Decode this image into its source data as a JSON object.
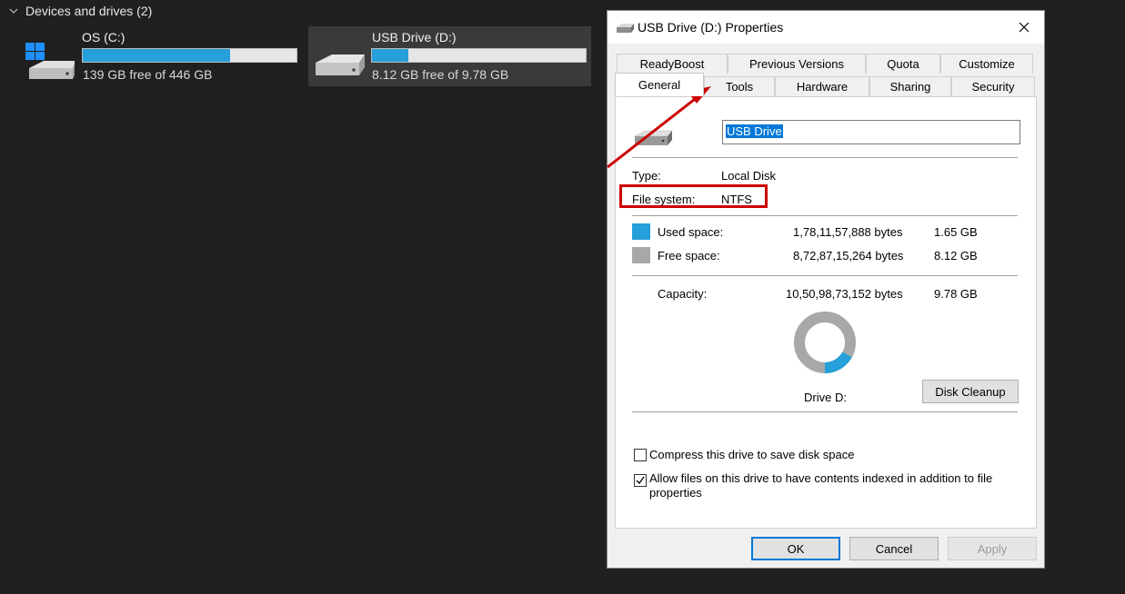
{
  "explorer": {
    "group_header": "Devices and drives (2)",
    "drives": [
      {
        "name": "OS (C:)",
        "free_text": "139 GB free of 446 GB",
        "used_fraction": 0.69,
        "selected": false
      },
      {
        "name": "USB Drive (D:)",
        "free_text": "8.12 GB free of 9.78 GB",
        "used_fraction": 0.17,
        "selected": true
      }
    ]
  },
  "dialog": {
    "title": "USB Drive (D:) Properties",
    "tabs_row1": [
      "ReadyBoost",
      "Previous Versions",
      "Quota",
      "Customize"
    ],
    "tabs_row2": [
      "General",
      "Tools",
      "Hardware",
      "Sharing",
      "Security"
    ],
    "active_tab": "General",
    "volume_name": "USB Drive",
    "type_label": "Type:",
    "type_value": "Local Disk",
    "fs_label": "File system:",
    "fs_value": "NTFS",
    "used_label": "Used space:",
    "used_bytes": "1,78,11,57,888 bytes",
    "used_gb": "1.65 GB",
    "free_label": "Free space:",
    "free_bytes": "8,72,87,15,264 bytes",
    "free_gb": "8.12 GB",
    "capacity_label": "Capacity:",
    "capacity_bytes": "10,50,98,73,152 bytes",
    "capacity_gb": "9.78 GB",
    "drive_label": "Drive D:",
    "used_fraction": 0.17,
    "disk_cleanup": "Disk Cleanup",
    "compress_label": "Compress this drive to save disk space",
    "compress_checked": false,
    "index_label_line1": "Allow files on this drive to have contents indexed in addition to file",
    "index_label_line2": "properties",
    "index_checked": true,
    "ok": "OK",
    "cancel": "Cancel",
    "apply": "Apply"
  },
  "colors": {
    "used": "#26a0da",
    "free": "#a8a8a8",
    "annotation": "#cc0000",
    "accent": "#0078d7"
  }
}
